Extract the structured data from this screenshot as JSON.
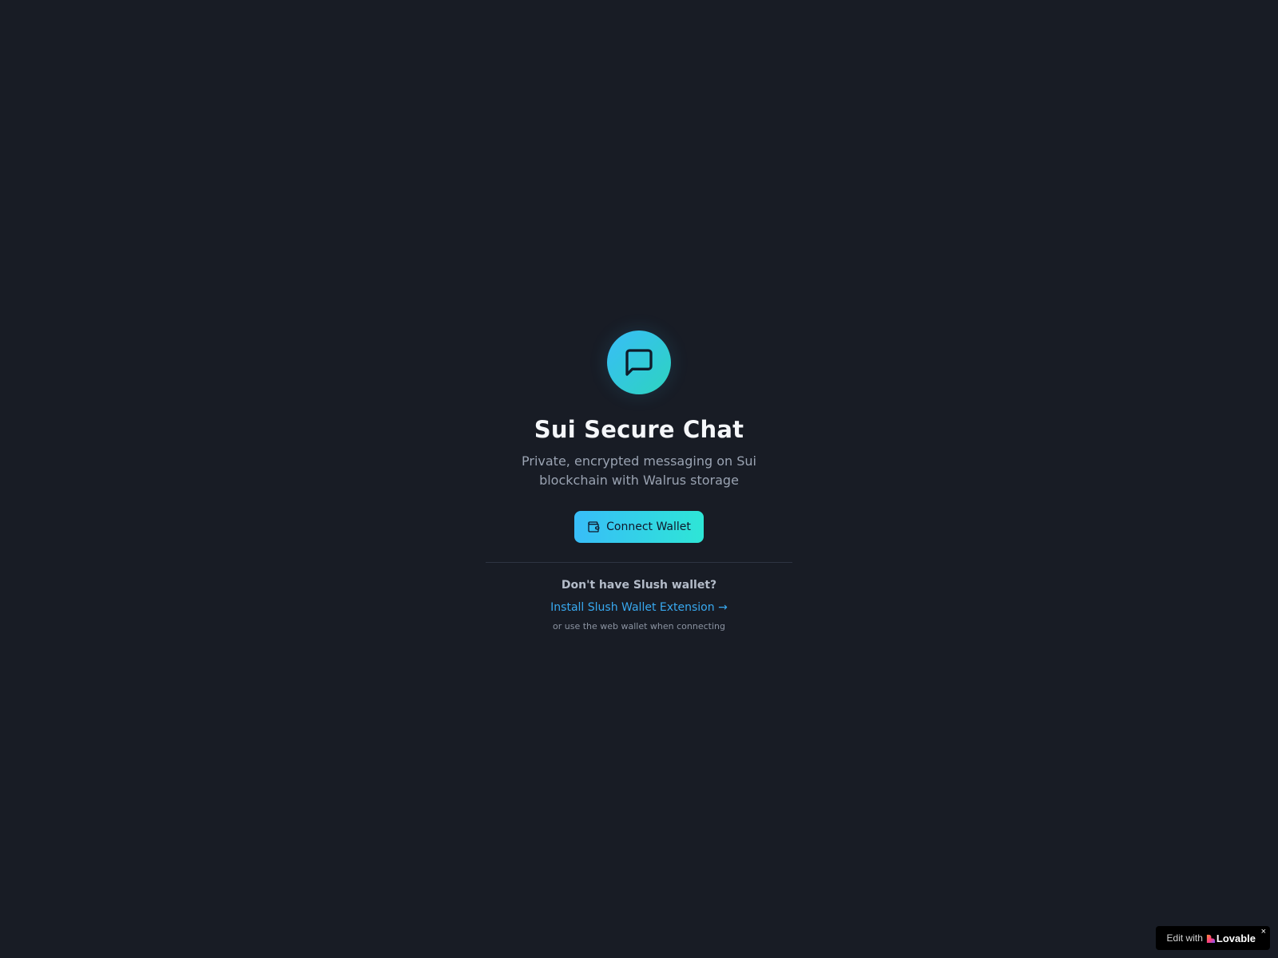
{
  "app": {
    "title": "Sui Secure Chat",
    "subtitle": "Private, encrypted messaging on Sui blockchain with Walrus storage",
    "logo_icon": "message-square-icon"
  },
  "actions": {
    "connect_label": "Connect Wallet",
    "connect_icon": "wallet-icon"
  },
  "help": {
    "question": "Don't have Slush wallet?",
    "install_link": "Install Slush Wallet Extension →",
    "hint": "or use the web wallet when connecting"
  },
  "badge": {
    "edit_text": "Edit with",
    "brand": "Lovable",
    "close": "×"
  },
  "colors": {
    "background": "#181c25",
    "accent_start": "#38bdf8",
    "accent_end": "#2dd4bf",
    "link": "#38a9f0"
  }
}
